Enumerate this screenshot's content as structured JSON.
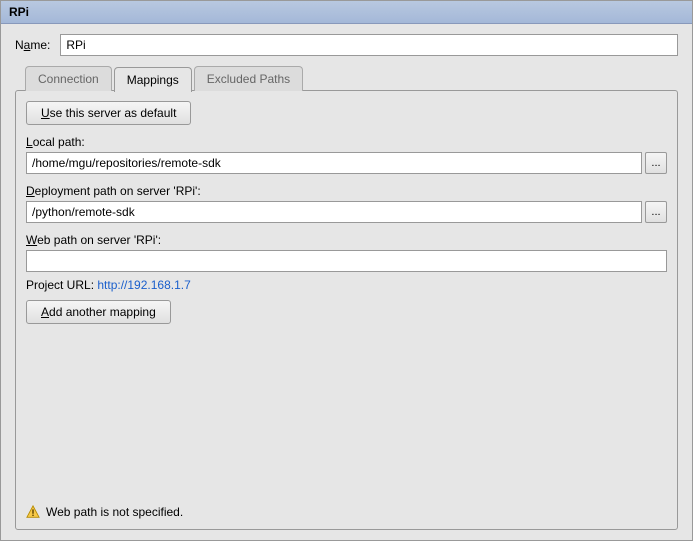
{
  "window": {
    "title": "RPi"
  },
  "name": {
    "label_pre": "N",
    "label_u": "a",
    "label_post": "me:",
    "value": "RPi"
  },
  "tabs": {
    "connection": "Connection",
    "mappings": "Mappings",
    "excluded": "Excluded Paths",
    "active": "mappings"
  },
  "mappings": {
    "default_btn_pre": "",
    "default_btn_u": "U",
    "default_btn_post": "se this server as default",
    "local_label_pre": "",
    "local_label_u": "L",
    "local_label_post": "ocal path:",
    "local_value": "/home/mgu/repositories/remote-sdk",
    "deploy_label_pre": "",
    "deploy_label_u": "D",
    "deploy_label_post": "eployment path on server 'RPi':",
    "deploy_value": "/python/remote-sdk",
    "web_label_pre": "",
    "web_label_u": "W",
    "web_label_post": "eb path on server 'RPi':",
    "web_value": "",
    "project_url_label": "Project URL: ",
    "project_url": "http://192.168.1.7",
    "add_btn_pre": "",
    "add_btn_u": "A",
    "add_btn_post": "dd another mapping",
    "browse": "..."
  },
  "warning": {
    "text": "Web path is not specified."
  }
}
